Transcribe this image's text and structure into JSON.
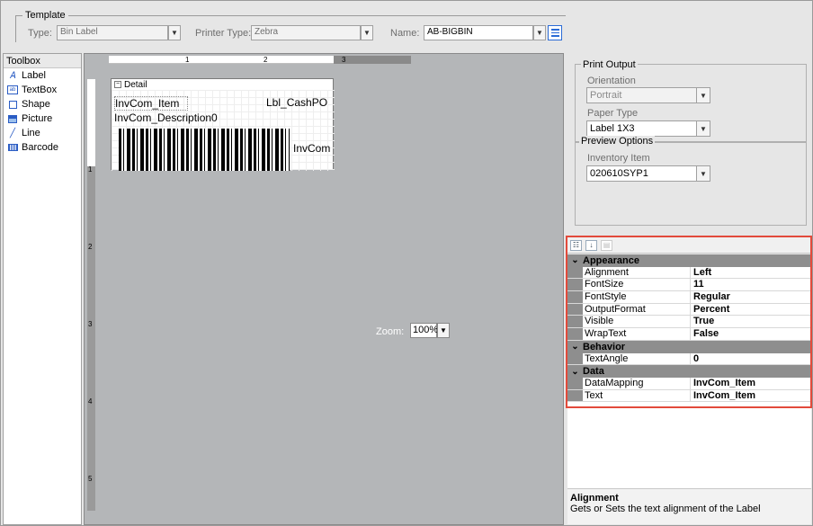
{
  "template": {
    "legend": "Template",
    "type_label": "Type:",
    "type_value": "Bin Label",
    "printer_label": "Printer Type:",
    "printer_value": "Zebra",
    "name_label": "Name:",
    "name_value": "AB-BIGBIN"
  },
  "toolbox": {
    "title": "Toolbox",
    "items": [
      {
        "label": "Label",
        "icon": "label-icon"
      },
      {
        "label": "TextBox",
        "icon": "textbox-icon"
      },
      {
        "label": "Shape",
        "icon": "shape-icon"
      },
      {
        "label": "Picture",
        "icon": "picture-icon"
      },
      {
        "label": "Line",
        "icon": "line-icon"
      },
      {
        "label": "Barcode",
        "icon": "barcode-icon"
      }
    ]
  },
  "designer": {
    "section": "Detail",
    "fields": {
      "item": "InvCom_Item",
      "cash": "Lbl_CashPO",
      "desc": "InvCom_Description0",
      "invcom": "InvCom"
    },
    "hruler": [
      "1",
      "2",
      "3"
    ],
    "vruler": [
      "1",
      "2",
      "3",
      "4",
      "5"
    ],
    "zoom_label": "Zoom:",
    "zoom_value": "100%"
  },
  "print_output": {
    "legend": "Print Output",
    "orientation_label": "Orientation",
    "orientation_value": "Portrait",
    "paper_label": "Paper Type",
    "paper_value": "Label 1X3"
  },
  "preview": {
    "legend": "Preview Options",
    "inventory_label": "Inventory Item",
    "inventory_value": "020610SYP1"
  },
  "properties": {
    "categories": [
      {
        "name": "Appearance",
        "rows": [
          {
            "name": "Alignment",
            "value": "Left"
          },
          {
            "name": "FontSize",
            "value": "11"
          },
          {
            "name": "FontStyle",
            "value": "Regular"
          },
          {
            "name": "OutputFormat",
            "value": "Percent"
          },
          {
            "name": "Visible",
            "value": "True"
          },
          {
            "name": "WrapText",
            "value": "False"
          }
        ]
      },
      {
        "name": "Behavior",
        "rows": [
          {
            "name": "TextAngle",
            "value": "0"
          }
        ]
      },
      {
        "name": "Data",
        "rows": [
          {
            "name": "DataMapping",
            "value": "InvCom_Item"
          },
          {
            "name": "Text",
            "value": "InvCom_Item"
          }
        ]
      }
    ],
    "description_title": "Alignment",
    "description_text": "Gets or Sets the text alignment of the Label"
  }
}
